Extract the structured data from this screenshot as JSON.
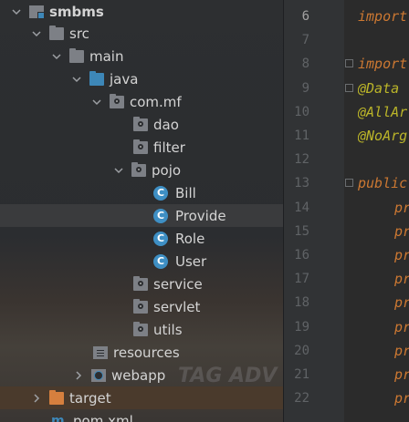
{
  "tree": {
    "items": [
      {
        "label": "smbms",
        "expanded": true,
        "icon": "module-icon"
      },
      {
        "label": "src",
        "expanded": true,
        "icon": "folder-icon"
      },
      {
        "label": "main",
        "expanded": true,
        "icon": "folder-icon"
      },
      {
        "label": "java",
        "expanded": true,
        "icon": "source-folder-icon"
      },
      {
        "label": "com.mf",
        "expanded": true,
        "icon": "package-icon"
      },
      {
        "label": "dao",
        "icon": "package-icon"
      },
      {
        "label": "filter",
        "icon": "package-icon"
      },
      {
        "label": "pojo",
        "expanded": true,
        "icon": "package-icon"
      },
      {
        "label": "Bill",
        "icon": "class-icon"
      },
      {
        "label": "Provide",
        "icon": "class-icon",
        "selected": true
      },
      {
        "label": "Role",
        "icon": "class-icon"
      },
      {
        "label": "User",
        "icon": "class-icon"
      },
      {
        "label": "service",
        "icon": "package-icon"
      },
      {
        "label": "servlet",
        "icon": "package-icon"
      },
      {
        "label": "utils",
        "icon": "package-icon"
      },
      {
        "label": "resources",
        "icon": "resources-folder-icon"
      },
      {
        "label": "webapp",
        "expanded": false,
        "icon": "web-folder-icon"
      },
      {
        "label": "target",
        "expanded": false,
        "icon": "excluded-folder-icon"
      },
      {
        "label": "pom.xml",
        "icon": "maven-icon"
      }
    ],
    "class_badge": "C",
    "maven_badge": "m"
  },
  "editor": {
    "lines": [
      {
        "num": "6",
        "text": "import",
        "style": "keyword"
      },
      {
        "num": "7",
        "text": "",
        "style": ""
      },
      {
        "num": "8",
        "text": "import",
        "style": "keyword"
      },
      {
        "num": "9",
        "text": "@Data",
        "style": "annotation"
      },
      {
        "num": "10",
        "text": "@AllAr",
        "style": "annotation"
      },
      {
        "num": "11",
        "text": "@NoArg",
        "style": "annotation"
      },
      {
        "num": "12",
        "text": "",
        "style": ""
      },
      {
        "num": "13",
        "text": "public",
        "style": "keyword"
      },
      {
        "num": "14",
        "text": "pr",
        "style": "keyword"
      },
      {
        "num": "15",
        "text": "pr",
        "style": "keyword"
      },
      {
        "num": "16",
        "text": "pr",
        "style": "keyword"
      },
      {
        "num": "17",
        "text": "pr",
        "style": "keyword"
      },
      {
        "num": "18",
        "text": "pr",
        "style": "keyword"
      },
      {
        "num": "19",
        "text": "pr",
        "style": "keyword"
      },
      {
        "num": "20",
        "text": "pr",
        "style": "keyword"
      },
      {
        "num": "21",
        "text": "pr",
        "style": "keyword"
      },
      {
        "num": "22",
        "text": "pr",
        "style": "keyword"
      }
    ]
  },
  "colors": {
    "keyword": "#cc7832",
    "annotation": "#bbb529",
    "accent_blue": "#3d87b8",
    "excluded_orange": "#d67f3e"
  }
}
